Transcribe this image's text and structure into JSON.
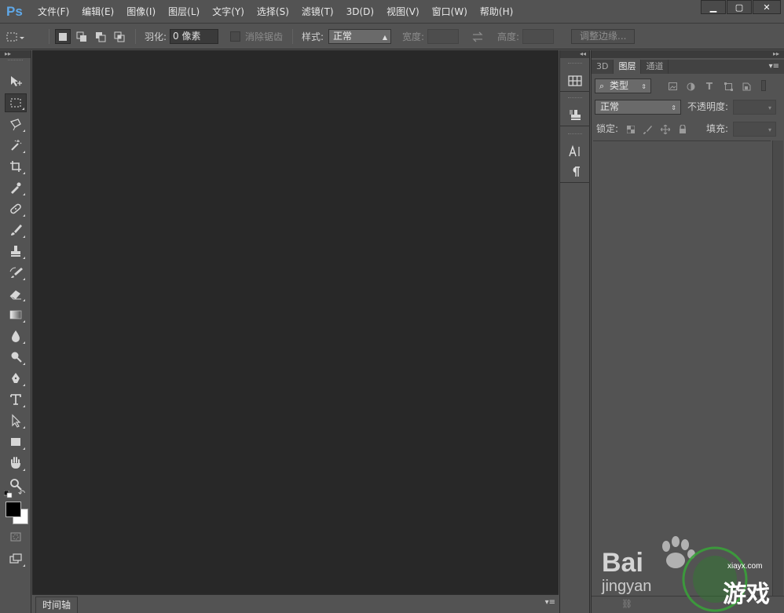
{
  "app": {
    "logo_text": "Ps"
  },
  "menu": {
    "items": [
      "文件(F)",
      "编辑(E)",
      "图像(I)",
      "图层(L)",
      "文字(Y)",
      "选择(S)",
      "滤镜(T)",
      "3D(D)",
      "视图(V)",
      "窗口(W)",
      "帮助(H)"
    ]
  },
  "window_controls": {
    "minimize": "▁",
    "maximize": "▢",
    "close": "✕"
  },
  "options_bar": {
    "feather_label": "羽化:",
    "feather_value": "0 像素",
    "antialias_label": "消除锯齿",
    "style_label": "样式:",
    "style_value": "正常",
    "width_label": "宽度:",
    "height_label": "高度:",
    "refine_edge_button": "调整边缘..."
  },
  "tools": [
    {
      "name": "move-tool"
    },
    {
      "name": "marquee-tool",
      "active": true
    },
    {
      "name": "lasso-tool"
    },
    {
      "name": "magic-wand-tool"
    },
    {
      "name": "crop-tool"
    },
    {
      "name": "eyedropper-tool"
    },
    {
      "name": "healing-brush-tool"
    },
    {
      "name": "brush-tool"
    },
    {
      "name": "clone-stamp-tool"
    },
    {
      "name": "history-brush-tool"
    },
    {
      "name": "eraser-tool"
    },
    {
      "name": "gradient-tool"
    },
    {
      "name": "blur-tool"
    },
    {
      "name": "dodge-tool"
    },
    {
      "name": "pen-tool"
    },
    {
      "name": "type-tool"
    },
    {
      "name": "path-selection-tool"
    },
    {
      "name": "rectangle-tool"
    },
    {
      "name": "hand-tool"
    },
    {
      "name": "zoom-tool"
    }
  ],
  "colors": {
    "foreground": "#000000",
    "background": "#ffffff",
    "canvas": "#282828",
    "ui": "#535353",
    "ps_blue": "#5fa8e8"
  },
  "timeline": {
    "tab_label": "时间轴"
  },
  "right_panel": {
    "tabs": [
      {
        "label": "3D",
        "active": false
      },
      {
        "label": "图层",
        "active": true
      },
      {
        "label": "通道",
        "active": false
      }
    ],
    "filter_kind": "类型",
    "blend_mode": "正常",
    "opacity_label": "不透明度:",
    "lock_label": "锁定:",
    "fill_label": "填充:"
  },
  "watermark": {
    "baidu": "Bai",
    "jingyan": "jingyan",
    "site": "xiayx.com",
    "game_text": "游戏"
  }
}
